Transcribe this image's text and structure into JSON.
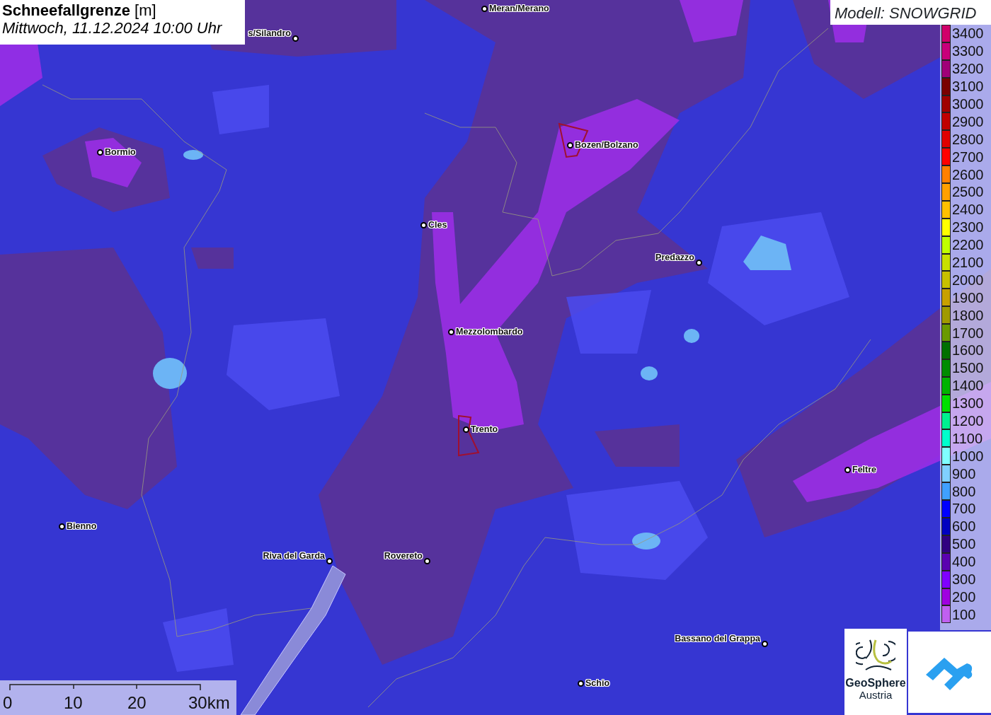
{
  "title": {
    "text": "**Schneefallgrenze** [m]",
    "subtitle": "Mittwoch, 11.12.2024 10:00 Uhr"
  },
  "model_label": "Modell: SNOWGRID",
  "cities": [
    {
      "name": "Meran/Merano"
    },
    {
      "name": "s/Silandro"
    },
    {
      "name": "Bormio"
    },
    {
      "name": "Bozen/Bolzano"
    },
    {
      "name": "Cles"
    },
    {
      "name": "Predazzo"
    },
    {
      "name": "Mezzolombardo"
    },
    {
      "name": "Trento"
    },
    {
      "name": "Feltre"
    },
    {
      "name": "Bienno"
    },
    {
      "name": "Riva del Garda"
    },
    {
      "name": "Rovereto"
    },
    {
      "name": "Bassano del Grappa"
    },
    {
      "name": "Schio"
    }
  ],
  "legend": [
    {
      "label": "3400",
      "color": "#d0006a"
    },
    {
      "label": "3300",
      "color": "#c8007a"
    },
    {
      "label": "3200",
      "color": "#a00078"
    },
    {
      "label": "3100",
      "color": "#7a0000"
    },
    {
      "label": "3000",
      "color": "#a00000"
    },
    {
      "label": "2900",
      "color": "#c00000"
    },
    {
      "label": "2800",
      "color": "#e00000"
    },
    {
      "label": "2700",
      "color": "#ff0000"
    },
    {
      "label": "2600",
      "color": "#ff8000"
    },
    {
      "label": "2500",
      "color": "#ffa000"
    },
    {
      "label": "2400",
      "color": "#ffc000"
    },
    {
      "label": "2300",
      "color": "#ffff00"
    },
    {
      "label": "2200",
      "color": "#c0ff00"
    },
    {
      "label": "2100",
      "color": "#c8e000"
    },
    {
      "label": "2000",
      "color": "#c8c000"
    },
    {
      "label": "1900",
      "color": "#c8a000"
    },
    {
      "label": "1800",
      "color": "#a09a00"
    },
    {
      "label": "1700",
      "color": "#6a9a00"
    },
    {
      "label": "1600",
      "color": "#007000"
    },
    {
      "label": "1500",
      "color": "#008c00"
    },
    {
      "label": "1400",
      "color": "#00b400"
    },
    {
      "label": "1300",
      "color": "#00e000"
    },
    {
      "label": "1200",
      "color": "#00f090"
    },
    {
      "label": "1100",
      "color": "#00ffcc"
    },
    {
      "label": "1000",
      "color": "#80ffff"
    },
    {
      "label": "900",
      "color": "#80d0ff"
    },
    {
      "label": "800",
      "color": "#40a0ff"
    },
    {
      "label": "700",
      "color": "#0000ff"
    },
    {
      "label": "600",
      "color": "#0000c0"
    },
    {
      "label": "500",
      "color": "#300080"
    },
    {
      "label": "400",
      "color": "#5a00b0"
    },
    {
      "label": "300",
      "color": "#8000ff"
    },
    {
      "label": "200",
      "color": "#a000e0"
    },
    {
      "label": "100",
      "color": "#c060f0"
    }
  ],
  "scale_bar": {
    "labels": [
      "0",
      "10",
      "20",
      "30km"
    ]
  },
  "logos": {
    "geosphere_name": "GeoSphere",
    "geosphere_country": "Austria"
  }
}
